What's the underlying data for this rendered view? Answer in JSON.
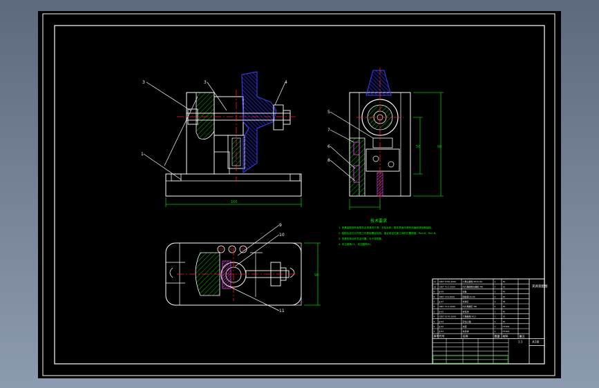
{
  "colors": {
    "background": "#000000",
    "frame": "#ffffff",
    "outline": "#ffffff",
    "hatch_section": "#00a800",
    "hatch_fixture": "#2020d8",
    "centerline": "#ff2020",
    "dimension": "#00c800",
    "notes": "#00ff00",
    "title_block": "#ffffff",
    "fastener": "#ff40ff"
  },
  "labels": {
    "front": [
      "3",
      "3",
      "4",
      "1"
    ],
    "side": [
      "5",
      "7",
      "6",
      "8"
    ],
    "plan": [
      "9",
      "10",
      "11"
    ]
  },
  "dimensions": {
    "front_width": "166",
    "side_height_inner": "56",
    "side_height_outer": "98",
    "plan_height": "98"
  },
  "notes": {
    "title": "技术要求",
    "lines": [
      "1. 夹具装配前所有零件必须清洗干净，去除毛刺，零件表面不得有划痕和锈蚀等缺陷。",
      "2. 装配后定位元件的工作表面需经检验，保证各定位面之间的位置精度，Ra0.8，Ra1.6。",
      "3. 夹紧机构动作灵活可靠，无卡滞现象。",
      "4. 未注倒角C1，未注圆角R2。"
    ]
  },
  "title_block": {
    "rows": [
      "11 | GB/T 5782-2000 | 六角头螺栓 M10×40 | 1 | 35",
      "10 | GB/T 70.1-2000 | 内六角圆柱头螺钉 M6 | 2 | 35",
      "9 | JJ-09 | 压板 | 1 | 45",
      "8 | GB/T 119-2000 | 圆柱销 6×30 | 2 | 45",
      "7 | JJ-07 | 支承钉 | 2 | T8",
      "6 | GB/T 70.1-2000 | 内六角螺钉 M8 | 4 | 35",
      "5 | JJ-05 | 定位块 | 1 | 45",
      "4 | GB/T 6170-2000 | 六角螺母 M12 | 1 | 35",
      "3 | JJ-03 | 定位心轴 | 1 | 45",
      "2 | JJ-02 | 支座 | 1 | HT200",
      "1 | JJ-01 | 夹具体 | 1 | HT200"
    ],
    "header": {
      "no": "序号",
      "code": "代号",
      "name": "名称",
      "qty": "数量",
      "material": "材料",
      "remark": "备注"
    },
    "title": "夹具装配图",
    "scale": "1:1",
    "sheet": "共1张"
  }
}
